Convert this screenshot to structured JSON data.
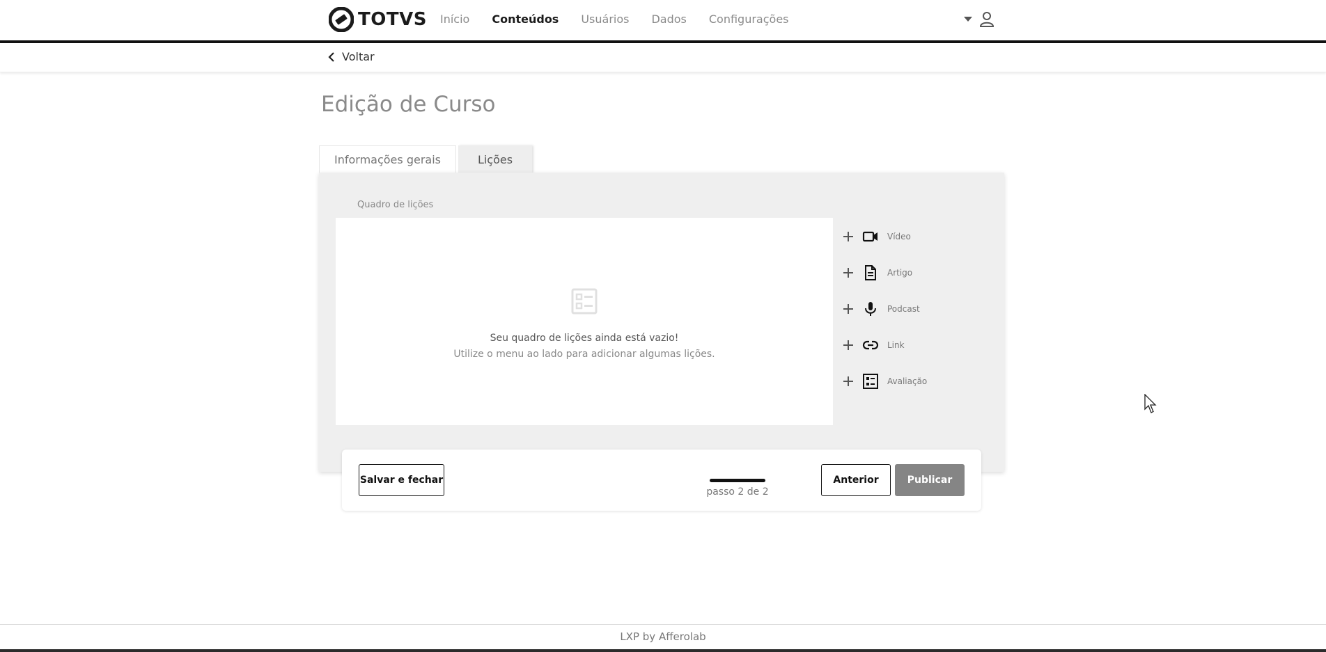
{
  "header": {
    "brand": "TOTVS",
    "nav": [
      "Início",
      "Conteúdos",
      "Usuários",
      "Dados",
      "Configurações"
    ],
    "active_nav": "Conteúdos",
    "user_icon": "user-icon",
    "dropdown_icon": "caret-down-icon"
  },
  "subbar": {
    "back_label": "Voltar"
  },
  "page": {
    "title": "Edição de Curso"
  },
  "tabs": [
    {
      "label": "Informações gerais"
    },
    {
      "label": "Lições"
    }
  ],
  "board": {
    "label": "Quadro de lições",
    "empty_title": "Seu quadro de lições ainda está vazio!",
    "empty_hint": "Utilize o menu ao lado para adicionar algumas lições."
  },
  "menu": {
    "items": [
      {
        "label": "Vídeo",
        "icon": "video-icon"
      },
      {
        "label": "Artigo",
        "icon": "article-icon"
      },
      {
        "label": "Podcast",
        "icon": "microphone-icon"
      },
      {
        "label": "Link",
        "icon": "link-icon"
      },
      {
        "label": "Avaliação",
        "icon": "checklist-icon"
      }
    ]
  },
  "stepbar": {
    "save_label": "Salvar e fechar",
    "step_text": "passo 2 de 2",
    "step_current": 2,
    "step_total": 2,
    "prev_label": "Anterior",
    "publish_label": "Publicar"
  },
  "footer": {
    "text": "LXP by Afferolab"
  },
  "colors": {
    "accent": "#111111",
    "publish_bg": "#858585",
    "panel_bg": "#efefef"
  }
}
